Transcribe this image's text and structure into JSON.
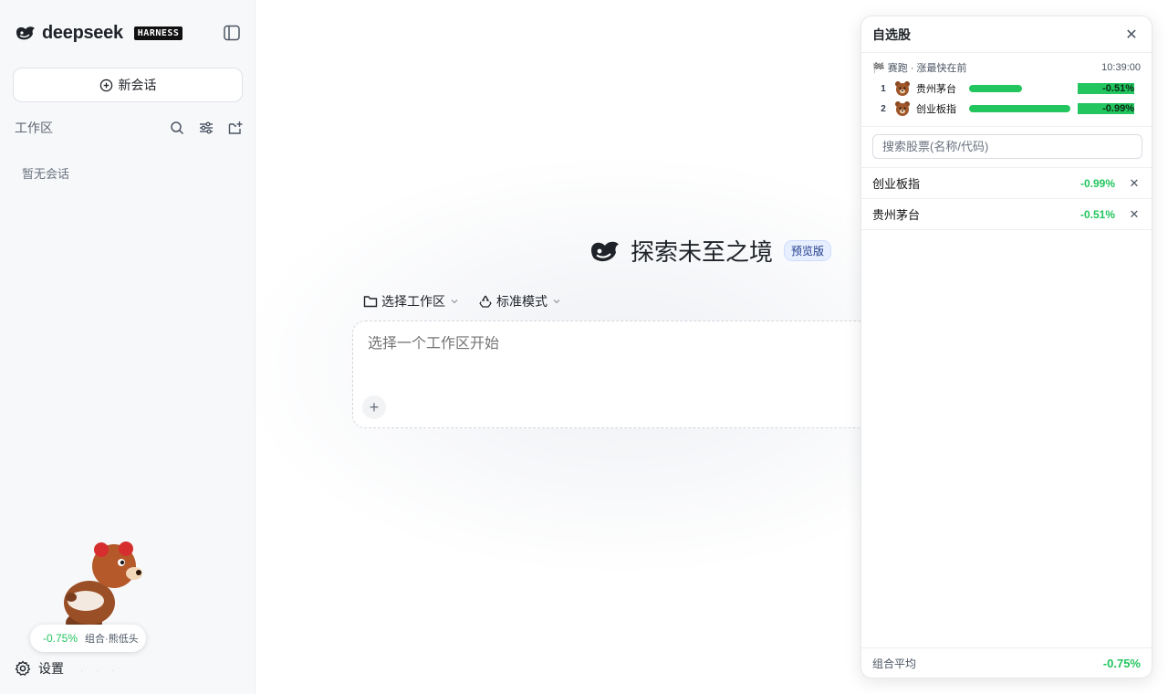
{
  "sidebar": {
    "brand_name": "deepseek",
    "brand_tag": "HARNESS",
    "new_chat_label": "新会话",
    "workspace_label": "工作区",
    "empty_text": "暂无会话",
    "settings_label": "设置",
    "status_pill": {
      "pct": "-0.75%",
      "label": "组合·熊低头"
    }
  },
  "main": {
    "hero_title": "探索未至之境",
    "hero_badge": "预览版",
    "select_workspace_label": "选择工作区",
    "mode_label": "标准模式",
    "composer_placeholder": "选择一个工作区开始"
  },
  "watchlist": {
    "title": "自选股",
    "race_title": "赛跑 · 涨最快在前",
    "race_time": "10:39:00",
    "race_rows": [
      {
        "rank": "1",
        "name": "贵州茅台",
        "pct": "-0.51%",
        "progress": 0.49
      },
      {
        "rank": "2",
        "name": "创业板指",
        "pct": "-0.99%",
        "progress": 0.94
      }
    ],
    "search_placeholder": "搜索股票(名称/代码)",
    "stocks": [
      {
        "name": "创业板指",
        "pct": "-0.99%"
      },
      {
        "name": "贵州茅台",
        "pct": "-0.51%"
      }
    ],
    "footer_label": "组合平均",
    "footer_value": "-0.75%"
  },
  "colors": {
    "accent_green": "#22c55e",
    "brand_dark": "#1f2329"
  }
}
